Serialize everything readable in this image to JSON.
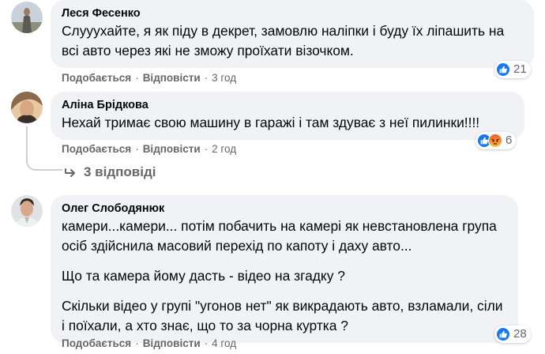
{
  "comments": [
    {
      "author": "Леся Фесенко",
      "paragraphs": [
        "Слууухайте, я як піду в декрет, замовлю наліпки і буду їх ліпашить на всі авто через які не зможу проїхати візочком."
      ],
      "actions": {
        "like": "Подобається",
        "reply": "Відповісти",
        "time": "3 год"
      },
      "reactions": {
        "icons": [
          "like-icon"
        ],
        "count": "21"
      }
    },
    {
      "author": "Аліна Брідкова",
      "paragraphs": [
        "Нехай тримає свою машину в гаражі і там здуває з неї пилинки!!!!"
      ],
      "actions": {
        "like": "Подобається",
        "reply": "Відповісти",
        "time": "2 год"
      },
      "reactions": {
        "icons": [
          "like-icon",
          "angry-icon"
        ],
        "count": "6"
      },
      "replies_label": "3 відповіді"
    },
    {
      "author": "Олег Слободянюк",
      "paragraphs": [
        "камери...камери... потім побачить на камері як невстановлена група осіб здійснила масовий перехід по капоту і даху авто...",
        "Що та камера йому дасть - відео на згадку ?",
        "Скільки відео у групі \"угонов нет\" як викрадають авто, взламали, сіли і поїхали, а хто знає, що то за чорна куртка ?"
      ],
      "actions": {
        "like": "Подобається",
        "reply": "Відповісти",
        "time": "4 год"
      },
      "reactions": {
        "icons": [
          "like-icon"
        ],
        "count": "28"
      }
    }
  ],
  "separator": "·",
  "colors": {
    "like": "#1877f2",
    "bubble": "#f0f2f5",
    "meta": "#65676b"
  }
}
